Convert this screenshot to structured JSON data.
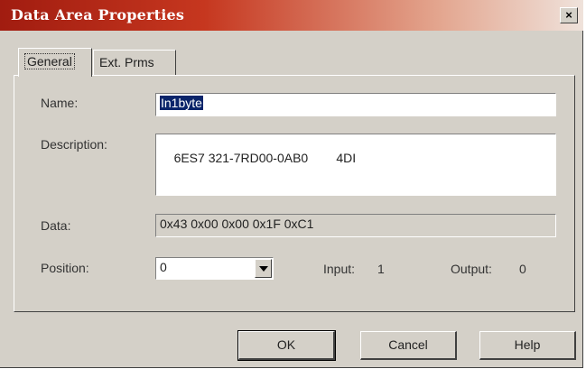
{
  "window": {
    "title": "Data Area Properties",
    "close_glyph": "×",
    "close_icon": "close-icon"
  },
  "tabs": [
    {
      "label": "General",
      "active": true
    },
    {
      "label": "Ext. Prms",
      "active": false
    }
  ],
  "form": {
    "name_label": "Name:",
    "name_value": "In1byte",
    "description_label": "Description:",
    "description_value": "6ES7 321-7RD00-0AB0        4DI",
    "data_label": "Data:",
    "data_value": "0x43 0x00 0x00 0x1F 0xC1",
    "position_label": "Position:",
    "position_value": "0",
    "input_label": "Input:",
    "input_value": "1",
    "output_label": "Output:",
    "output_value": "0"
  },
  "buttons": {
    "ok": "OK",
    "cancel": "Cancel",
    "help": "Help"
  }
}
